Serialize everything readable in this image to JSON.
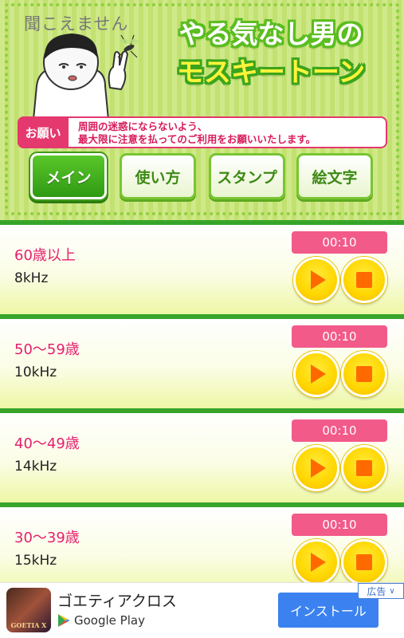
{
  "header": {
    "tagline": "聞こえません",
    "title_line1": "やる気なし男の",
    "title_line2": "モスキートーン",
    "notice_label": "お願い",
    "notice_line1": "周囲の迷惑にならないよう、",
    "notice_line2": "最大限に注意を払ってのご利用をお願いいたします。"
  },
  "tabs": [
    {
      "label": "メイン",
      "active": true
    },
    {
      "label": "使い方",
      "active": false
    },
    {
      "label": "スタンプ",
      "active": false
    },
    {
      "label": "絵文字",
      "active": false
    }
  ],
  "tones": [
    {
      "age": "60歳以上",
      "freq": "8kHz",
      "duration": "00:10"
    },
    {
      "age": "50〜59歳",
      "freq": "10kHz",
      "duration": "00:10"
    },
    {
      "age": "40〜49歳",
      "freq": "14kHz",
      "duration": "00:10"
    },
    {
      "age": "30〜39歳",
      "freq": "15kHz",
      "duration": "00:10"
    }
  ],
  "ad": {
    "app_name": "ゴエティアクロス",
    "store": "Google Play",
    "install": "インストール",
    "badge": "広告",
    "icon_text": "GOETIA X"
  },
  "colors": {
    "accent_green": "#37a52a",
    "accent_pink": "#e4206c",
    "button_yellow": "#ffd600",
    "button_orange": "#ff6a00",
    "install_blue": "#3b82f0"
  }
}
